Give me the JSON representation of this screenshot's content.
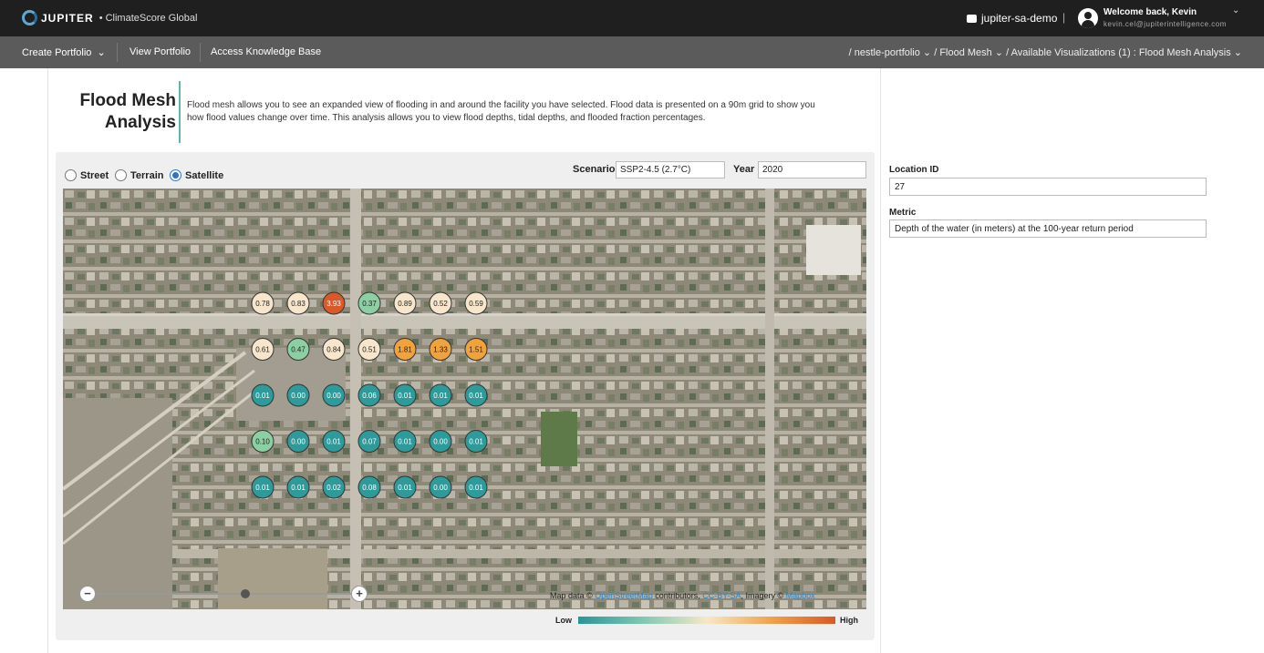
{
  "header": {
    "logo": "JUPITER",
    "product": "• ClimateScore Global",
    "tenant": "jupiter-sa-demo",
    "separator": "|",
    "welcome": "Welcome back, Kevin",
    "email": "kevin.cel@jupiterintelligence.com"
  },
  "nav": {
    "create_portfolio": "Create Portfolio",
    "view_portfolio": "View Portfolio",
    "knowledge_base": "Access Knowledge Base",
    "breadcrumb": "/ nestle-portfolio ⌄  / Flood Mesh ⌄  / Available Visualizations (1) : Flood Mesh Analysis ⌄"
  },
  "page": {
    "title_line1": "Flood Mesh",
    "title_line2": "Analysis",
    "description": "Flood mesh allows you to see an expanded view of flooding in and around the facility you have selected. Flood data is presented on a 90m grid to show you how flood values change over time. This analysis allows you to view flood depths, tidal depths, and flooded fraction percentages."
  },
  "map_controls": {
    "layers": [
      "Street",
      "Terrain",
      "Satellite"
    ],
    "selected_layer": "Satellite",
    "scenario_label": "Scenario",
    "scenario_value": "SSP2-4.5 (2.7°C)",
    "year_label": "Year",
    "year_value": "2020"
  },
  "map": {
    "zoom_out": "−",
    "zoom_in": "+",
    "attribution_prefix": "Map data ©",
    "attribution_osm": "OpenStreetMap",
    "attribution_mid": "contributors,",
    "attribution_cc": "CC-BY-SA",
    "attribution_imagery": ", Imagery ©",
    "attribution_mapbox": "Mapbox",
    "colors": {
      "teal": "#2f9a9a",
      "green": "#8ccfa3",
      "cream": "#f7e6cc",
      "orange": "#f0a33d",
      "red": "#d9592a"
    },
    "grid": [
      [
        {
          "v": "0.78",
          "c": "cream"
        },
        {
          "v": "0.83",
          "c": "cream"
        },
        {
          "v": "3.93",
          "c": "red"
        },
        {
          "v": "0.37",
          "c": "green"
        },
        {
          "v": "0.89",
          "c": "cream"
        },
        {
          "v": "0.52",
          "c": "cream"
        },
        {
          "v": "0.59",
          "c": "cream"
        }
      ],
      [
        {
          "v": "0.61",
          "c": "cream"
        },
        {
          "v": "0.47",
          "c": "green"
        },
        {
          "v": "0.84",
          "c": "cream"
        },
        {
          "v": "0.51",
          "c": "cream"
        },
        {
          "v": "1.81",
          "c": "orange"
        },
        {
          "v": "1.33",
          "c": "orange"
        },
        {
          "v": "1.51",
          "c": "orange"
        }
      ],
      [
        {
          "v": "0.01",
          "c": "teal"
        },
        {
          "v": "0.00",
          "c": "teal"
        },
        {
          "v": "0.00",
          "c": "teal"
        },
        {
          "v": "0.06",
          "c": "teal"
        },
        {
          "v": "0.01",
          "c": "teal"
        },
        {
          "v": "0.01",
          "c": "teal"
        },
        {
          "v": "0.01",
          "c": "teal"
        }
      ],
      [
        {
          "v": "0.10",
          "c": "green"
        },
        {
          "v": "0.00",
          "c": "teal"
        },
        {
          "v": "0.01",
          "c": "teal"
        },
        {
          "v": "0.07",
          "c": "teal"
        },
        {
          "v": "0.01",
          "c": "teal"
        },
        {
          "v": "0.00",
          "c": "teal"
        },
        {
          "v": "0.01",
          "c": "teal"
        }
      ],
      [
        {
          "v": "0.01",
          "c": "teal"
        },
        {
          "v": "0.01",
          "c": "teal"
        },
        {
          "v": "0.02",
          "c": "teal"
        },
        {
          "v": "0.08",
          "c": "teal"
        },
        {
          "v": "0.01",
          "c": "teal"
        },
        {
          "v": "0.00",
          "c": "teal"
        },
        {
          "v": "0.01",
          "c": "teal"
        }
      ]
    ]
  },
  "legend": {
    "low": "Low",
    "high": "High"
  },
  "sidebar": {
    "location_id_label": "Location ID",
    "location_id_value": "27",
    "metric_label": "Metric",
    "metric_value": "Depth of the water (in meters) at the 100-year return period"
  }
}
